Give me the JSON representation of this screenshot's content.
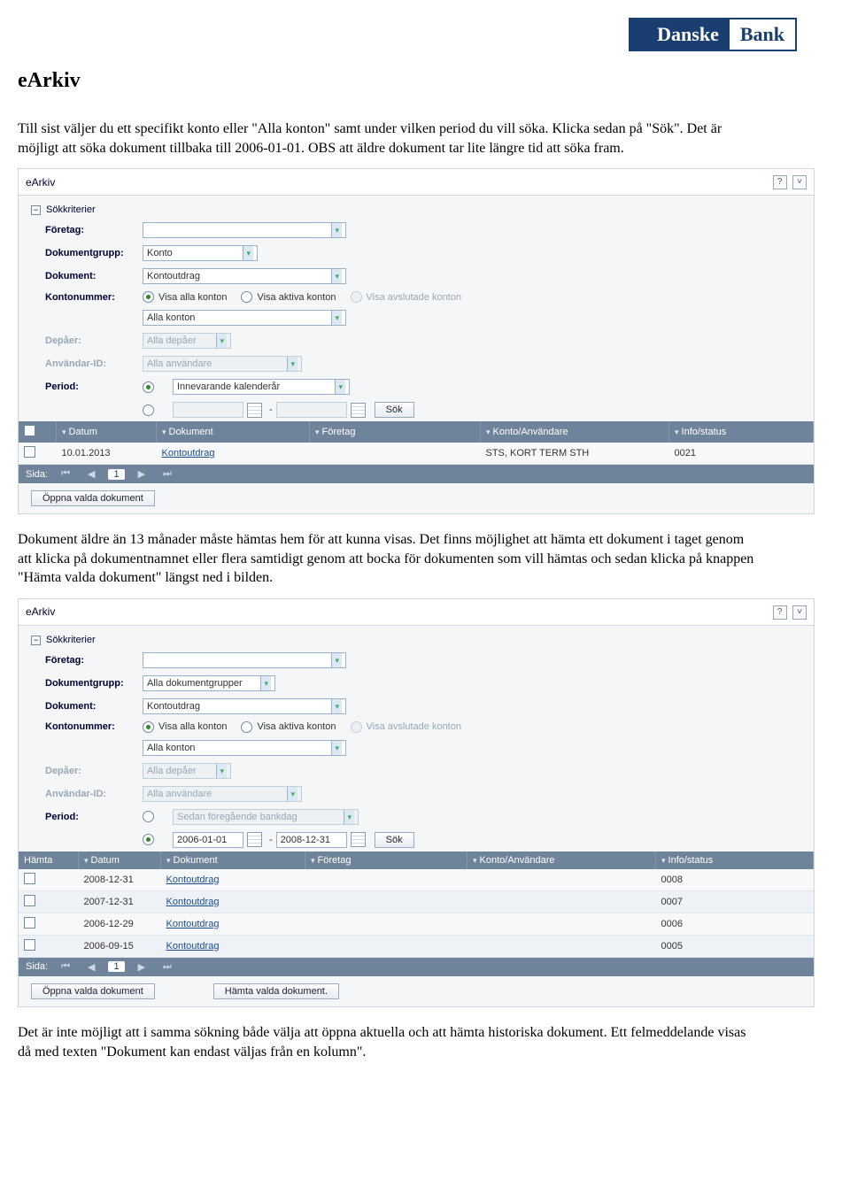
{
  "logo": {
    "part1": "Danske",
    "part2": "Bank"
  },
  "doc_title": "eArkiv",
  "para1": "Till sist väljer du ett specifikt konto eller \"Alla konton\" samt under vilken period du vill söka. Klicka sedan på \"Sök\". Det är möjligt att söka dokument tillbaka till 2006-01-01. OBS att äldre dokument tar lite längre tid att söka fram.",
  "para2": "Dokument äldre än 13 månader måste hämtas hem för att kunna visas. Det finns möjlighet att hämta ett dokument i taget genom att klicka på dokumentnamnet eller flera samtidigt genom att bocka för dokumenten som vill hämtas och sedan klicka på knappen \"Hämta valda dokument\" längst ned i bilden.",
  "para3": "Det är inte möjligt att i samma sökning både välja att öppna aktuella och att hämta historiska dokument. Ett felmeddelande visas då med texten \"Dokument kan endast väljas från en kolumn\".",
  "shot1": {
    "title": "eArkiv",
    "section": "Sökkriterier",
    "labels": {
      "foretag": "Företag:",
      "dokgrupp": "Dokumentgrupp:",
      "dokument": "Dokument:",
      "konto": "Kontonummer:",
      "depaer": "Depåer:",
      "anvid": "Användar-ID:",
      "period": "Period:"
    },
    "values": {
      "dokgrupp": "Konto",
      "dokument": "Kontoutdrag",
      "radio_all": "Visa alla konton",
      "radio_active": "Visa aktiva konton",
      "radio_closed": "Visa avslutade konton",
      "konto_sel": "Alla konton",
      "depaer": "Alla depåer",
      "anvid": "Alla användare",
      "period_sel": "Innevarande kalenderår",
      "sep": "-",
      "sok": "Sök"
    },
    "table": {
      "headers": [
        "",
        "Datum",
        "Dokument",
        "Företag",
        "Konto/Användare",
        "Info/status"
      ],
      "row": {
        "datum": "10.01.2013",
        "dok": "Kontoutdrag",
        "konto": "STS, KORT TERM STH",
        "info": "0021"
      }
    },
    "pager": {
      "label": "Sida:",
      "current": "1"
    },
    "open_btn": "Öppna valda dokument"
  },
  "shot2": {
    "title": "eArkiv",
    "section": "Sökkriterier",
    "labels": {
      "foretag": "Företag:",
      "dokgrupp": "Dokumentgrupp:",
      "dokument": "Dokument:",
      "konto": "Kontonummer:",
      "depaer": "Depåer:",
      "anvid": "Användar-ID:",
      "period": "Period:"
    },
    "values": {
      "dokgrupp": "Alla dokumentgrupper",
      "dokument": "Kontoutdrag",
      "radio_all": "Visa alla konton",
      "radio_active": "Visa aktiva konton",
      "radio_closed": "Visa avslutade konton",
      "konto_sel": "Alla konton",
      "depaer": "Alla depåer",
      "anvid": "Alla användare",
      "period_prev": "Sedan föregående bankdag",
      "from": "2006-01-01",
      "to": "2008-12-31",
      "sep": "-",
      "sok": "Sök"
    },
    "table": {
      "headers": [
        "Hämta",
        "Datum",
        "Dokument",
        "Företag",
        "Konto/Användare",
        "Info/status"
      ],
      "rows": [
        {
          "datum": "2008-12-31",
          "dok": "Kontoutdrag",
          "info": "0008"
        },
        {
          "datum": "2007-12-31",
          "dok": "Kontoutdrag",
          "info": "0007"
        },
        {
          "datum": "2006-12-29",
          "dok": "Kontoutdrag",
          "info": "0006"
        },
        {
          "datum": "2006-09-15",
          "dok": "Kontoutdrag",
          "info": "0005"
        }
      ]
    },
    "pager": {
      "label": "Sida:",
      "current": "1"
    },
    "open_btn": "Öppna valda dokument",
    "fetch_btn": "Hämta valda dokument."
  }
}
